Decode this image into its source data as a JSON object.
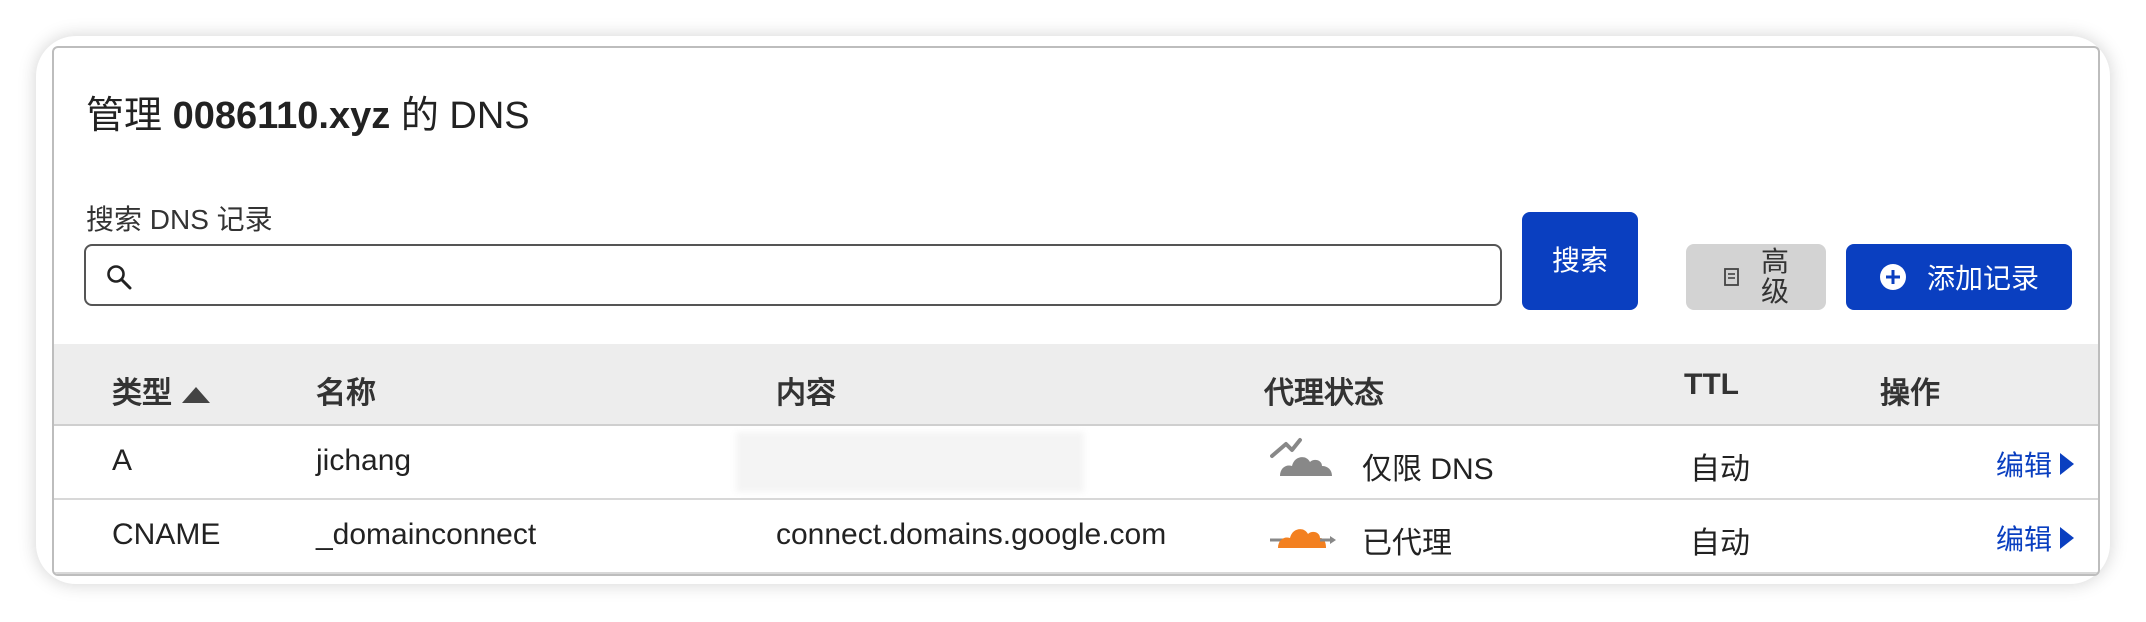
{
  "header": {
    "title_prefix": "管理",
    "domain": "0086110.xyz",
    "title_suffix": "的 DNS"
  },
  "search": {
    "label": "搜索 DNS 记录",
    "value": "",
    "placeholder": "",
    "button_label": "搜索"
  },
  "toolbar": {
    "advanced_label": "高级",
    "add_record_label": "添加记录"
  },
  "table": {
    "columns": [
      "类型",
      "名称",
      "内容",
      "代理状态",
      "TTL",
      "操作"
    ],
    "rows": [
      {
        "type": "A",
        "name": "jichang",
        "content": "",
        "proxy_status": "仅限 DNS",
        "ttl": "自动",
        "action": "编辑"
      },
      {
        "type": "CNAME",
        "name": "_domainconnect",
        "content": "connect.domains.google.com",
        "proxy_status": "已代理",
        "ttl": "自动",
        "action": "编辑"
      }
    ]
  },
  "colors": {
    "primary": "#0a3fc0",
    "proxied_orange": "#f38020",
    "dns_only_gray": "#888888"
  }
}
